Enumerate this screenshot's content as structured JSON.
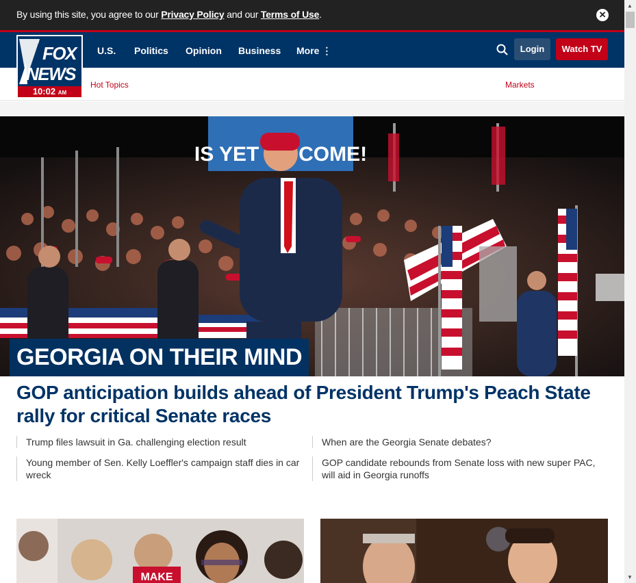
{
  "cookie": {
    "text_prefix": "By using this site, you agree to our ",
    "privacy": "Privacy Policy",
    "text_mid": " and our ",
    "terms": "Terms of Use",
    "text_suffix": ".",
    "close": "✕"
  },
  "logo": {
    "line1": "FOX",
    "line2": "NEWS",
    "time": "10:02",
    "ampm": "AM"
  },
  "nav": {
    "items": [
      "U.S.",
      "Politics",
      "Opinion",
      "Business",
      "More ⋮"
    ],
    "login": "Login",
    "watch": "Watch TV"
  },
  "subnav": {
    "hot_topics": "Hot Topics",
    "markets": "Markets"
  },
  "hero": {
    "kicker": "GEORGIA ON THEIR MIND",
    "headline": "GOP anticipation builds ahead of President Trump's Peach State rally for critical Senate races",
    "sign_text": "IS YET TO COME!"
  },
  "related": [
    "Trump files lawsuit in Ga. challenging election result",
    "When are the Georgia Senate debates?",
    "Young member of Sen. Kelly Loeffler's campaign staff dies in car wreck",
    "GOP candidate rebounds from Senate loss with new super PAC, will aid in Georgia runoffs"
  ],
  "cards": {
    "left_sign": "MAKE"
  },
  "colors": {
    "navy": "#003366",
    "red": "#c20017",
    "cookie_bg": "#222222"
  }
}
